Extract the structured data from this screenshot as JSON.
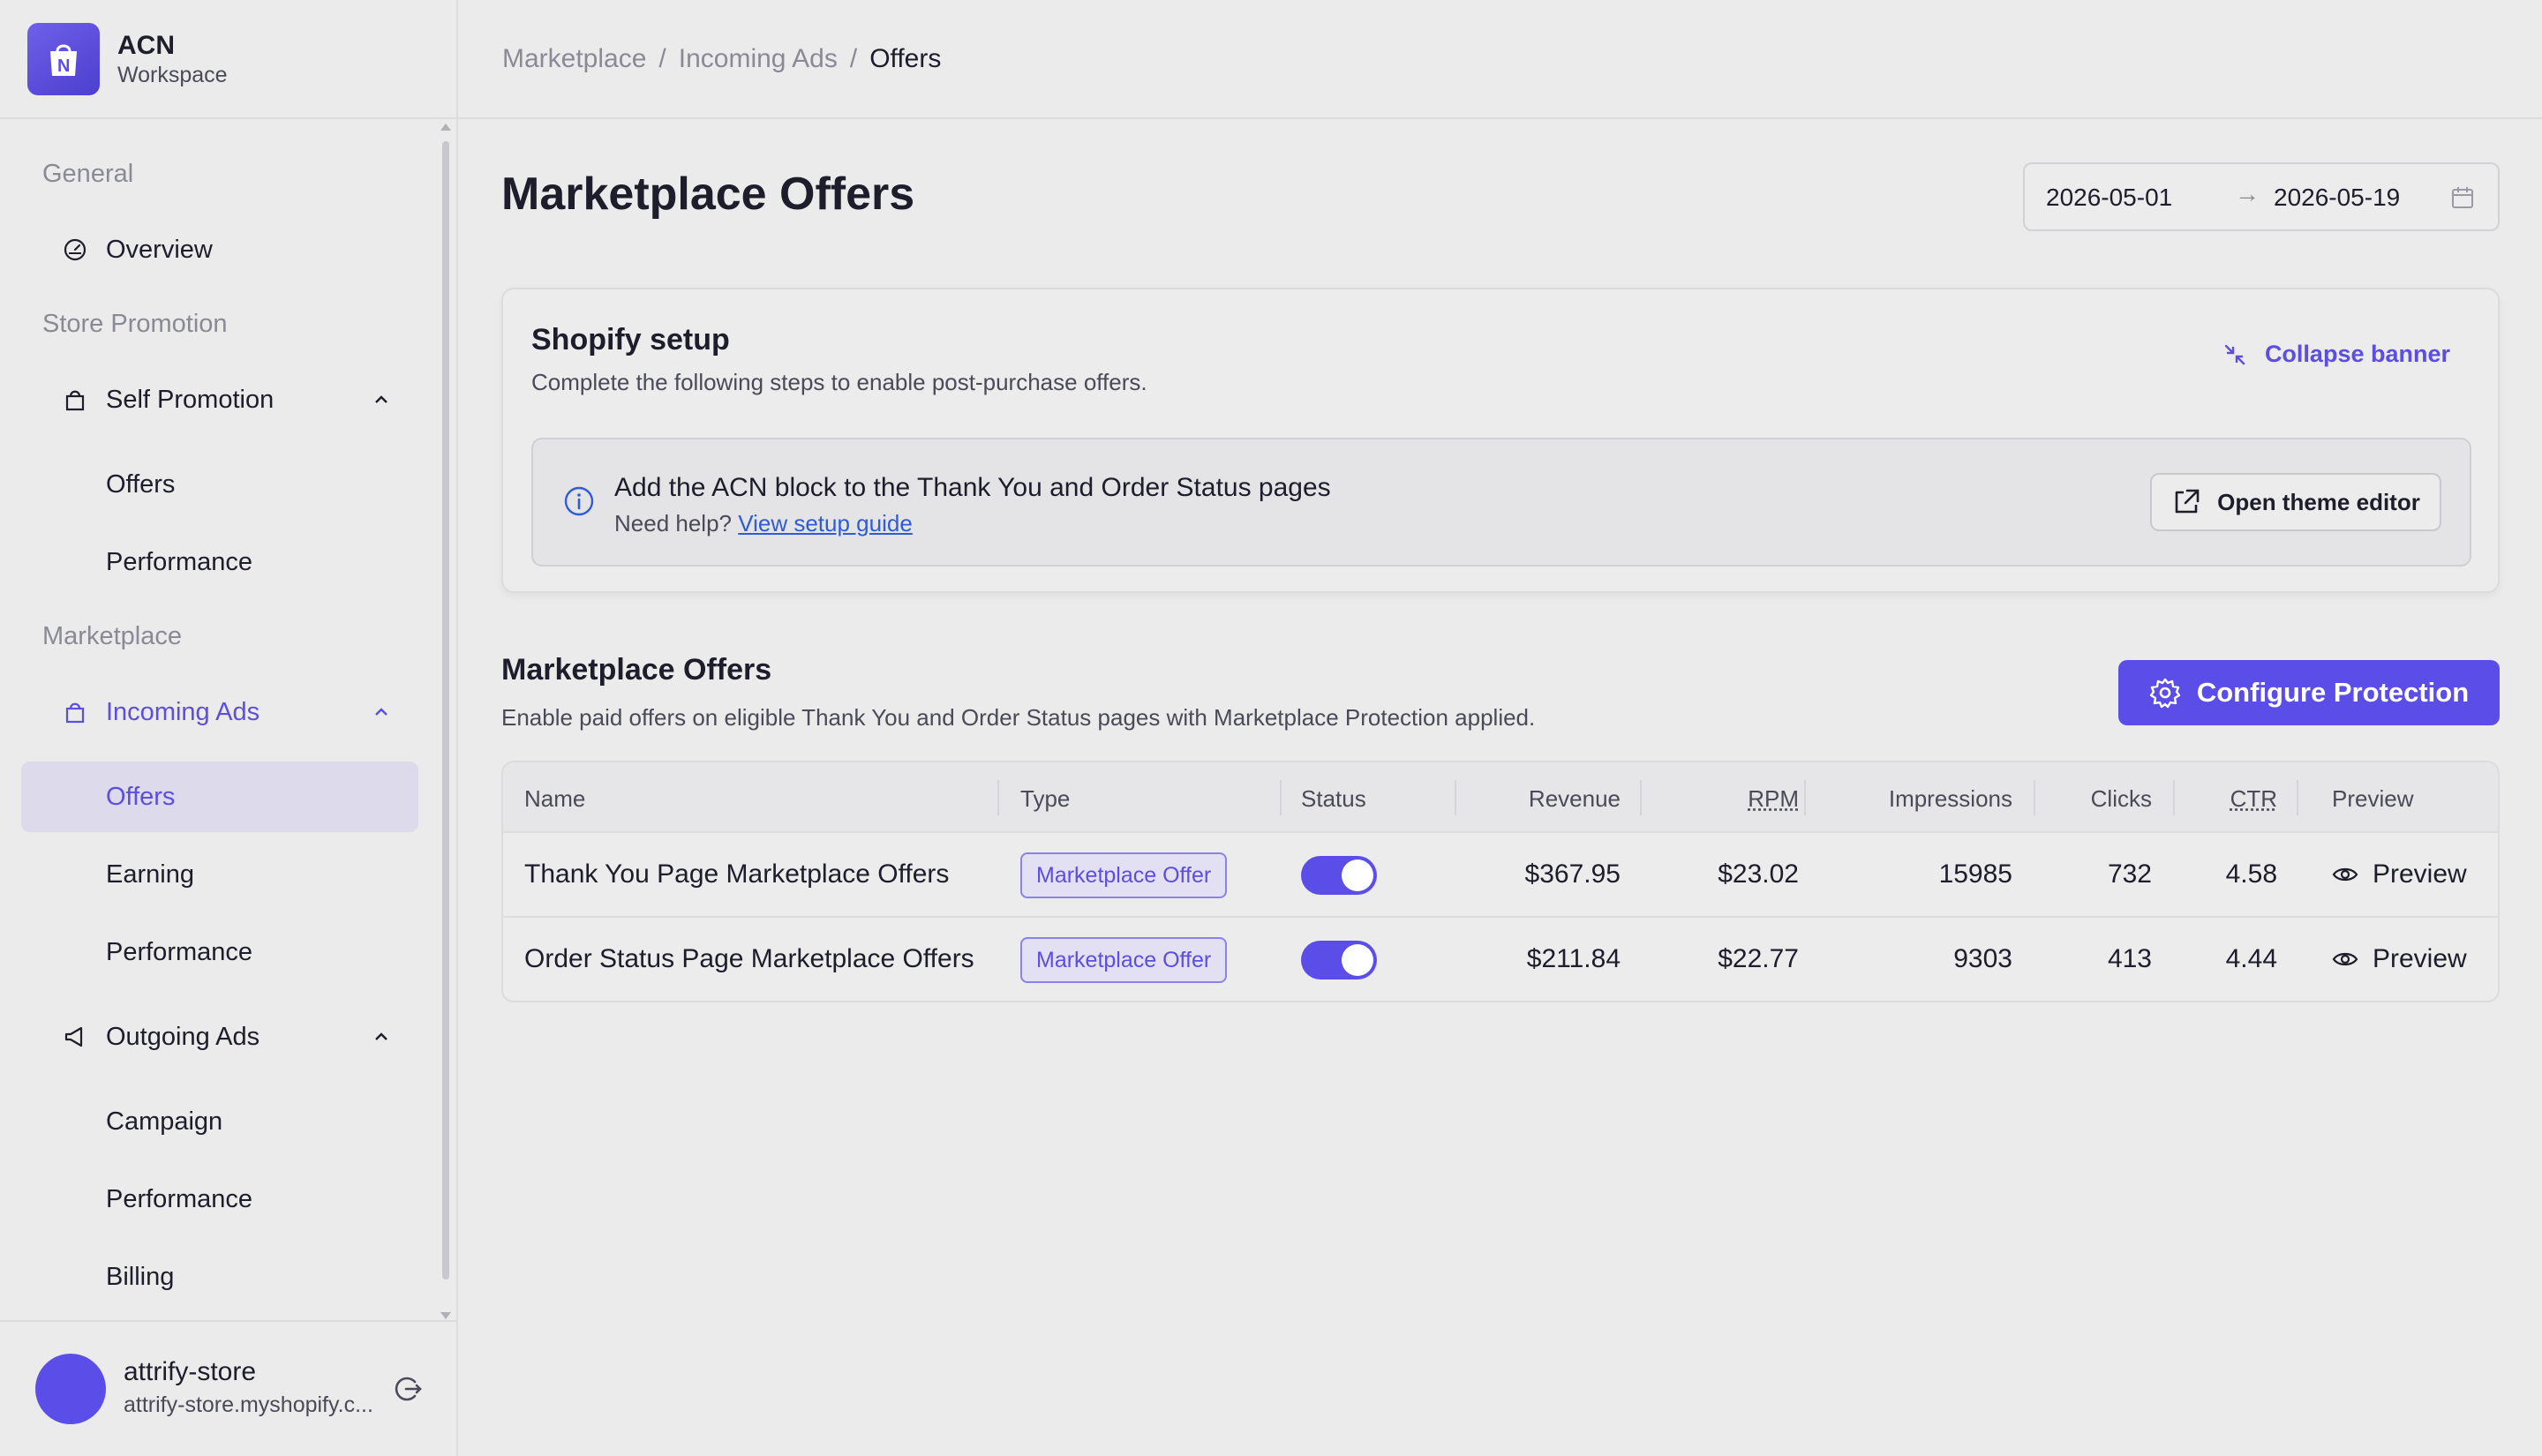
{
  "brand": {
    "name": "ACN",
    "subtitle": "Workspace"
  },
  "sidebar": {
    "sections": [
      {
        "title": "General"
      },
      {
        "title": "Store Promotion"
      },
      {
        "title": "Marketplace"
      }
    ],
    "items": {
      "overview": "Overview",
      "self_promotion": "Self Promotion",
      "self_offers": "Offers",
      "self_performance": "Performance",
      "incoming_ads": "Incoming Ads",
      "incoming_offers": "Offers",
      "incoming_earning": "Earning",
      "incoming_performance": "Performance",
      "outgoing_ads": "Outgoing Ads",
      "outgoing_campaign": "Campaign",
      "outgoing_performance": "Performance",
      "outgoing_billing": "Billing"
    }
  },
  "user": {
    "name": "attrify-store",
    "domain": "attrify-store.myshopify.c..."
  },
  "breadcrumb": {
    "item1": "Marketplace",
    "item2": "Incoming Ads",
    "current": "Offers",
    "separator": "/"
  },
  "page": {
    "title": "Marketplace Offers"
  },
  "date_range": {
    "start": "2026-05-01",
    "end": "2026-05-19",
    "arrow": "→"
  },
  "setup": {
    "title": "Shopify setup",
    "description": "Complete the following steps to enable post-purchase offers.",
    "collapse_label": "Collapse banner",
    "step_title": "Add the ACN block to the Thank You and Order Status pages",
    "help_prefix": "Need help?",
    "help_link": "View setup guide",
    "theme_button": "Open theme editor"
  },
  "offers_section": {
    "title": "Marketplace Offers",
    "description": "Enable paid offers on eligible Thank You and Order Status pages with Marketplace Protection applied.",
    "configure_button": "Configure Protection"
  },
  "table": {
    "columns": {
      "name": "Name",
      "type": "Type",
      "status": "Status",
      "revenue": "Revenue",
      "rpm": "RPM",
      "impressions": "Impressions",
      "clicks": "Clicks",
      "ctr": "CTR",
      "preview": "Preview"
    },
    "rows": [
      {
        "name": "Thank You Page Marketplace Offers",
        "type": "Marketplace Offer",
        "status": true,
        "revenue": "$367.95",
        "rpm": "$23.02",
        "impressions": "15985",
        "clicks": "732",
        "ctr": "4.58",
        "preview": "Preview"
      },
      {
        "name": "Order Status Page Marketplace Offers",
        "type": "Marketplace Offer",
        "status": true,
        "revenue": "$211.84",
        "rpm": "$22.77",
        "impressions": "9303",
        "clicks": "413",
        "ctr": "4.44",
        "preview": "Preview"
      }
    ]
  },
  "colors": {
    "accent": "#5b4ee8",
    "link": "#2e5bd6",
    "background": "#ebebeb"
  },
  "icons": {
    "overview": "gauge-icon",
    "self_promotion": "bag-icon",
    "incoming_ads": "bag-icon",
    "outgoing_ads": "megaphone-icon",
    "logout": "logout-icon",
    "calendar": "calendar-icon",
    "info": "info-icon",
    "external": "external-link-icon",
    "settings": "gear-icon",
    "preview": "eye-icon",
    "collapse": "collapse-icon"
  }
}
